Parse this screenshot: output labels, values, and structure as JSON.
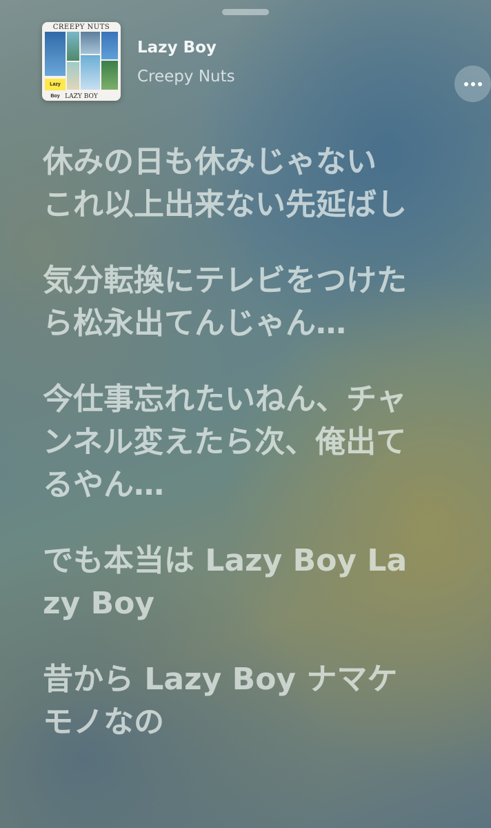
{
  "now_playing": {
    "title": "Lazy Boy",
    "artist": "Creepy Nuts",
    "artwork": {
      "band_text": "CREEPY NUTS",
      "sticker_text": "Lazy Boy",
      "album_text": "LAZY BOY"
    }
  },
  "controls": {
    "more_icon": "ellipsis-icon",
    "grabber_icon": "sheet-grabber"
  },
  "lyrics": [
    "休みの日も休みじゃない これ以上出来ない先延ばし",
    "気分転換にテレビをつけたら松永出てんじゃん…",
    "今仕事忘れたいねん、チャンネル変えたら次、俺出てるやん…",
    "でも本当は Lazy Boy Lazy Boy",
    "昔から Lazy Boy ナマケモノなの"
  ],
  "colors": {
    "lyric_text": "#ecf2f0",
    "title_text": "#f3f6f7"
  }
}
